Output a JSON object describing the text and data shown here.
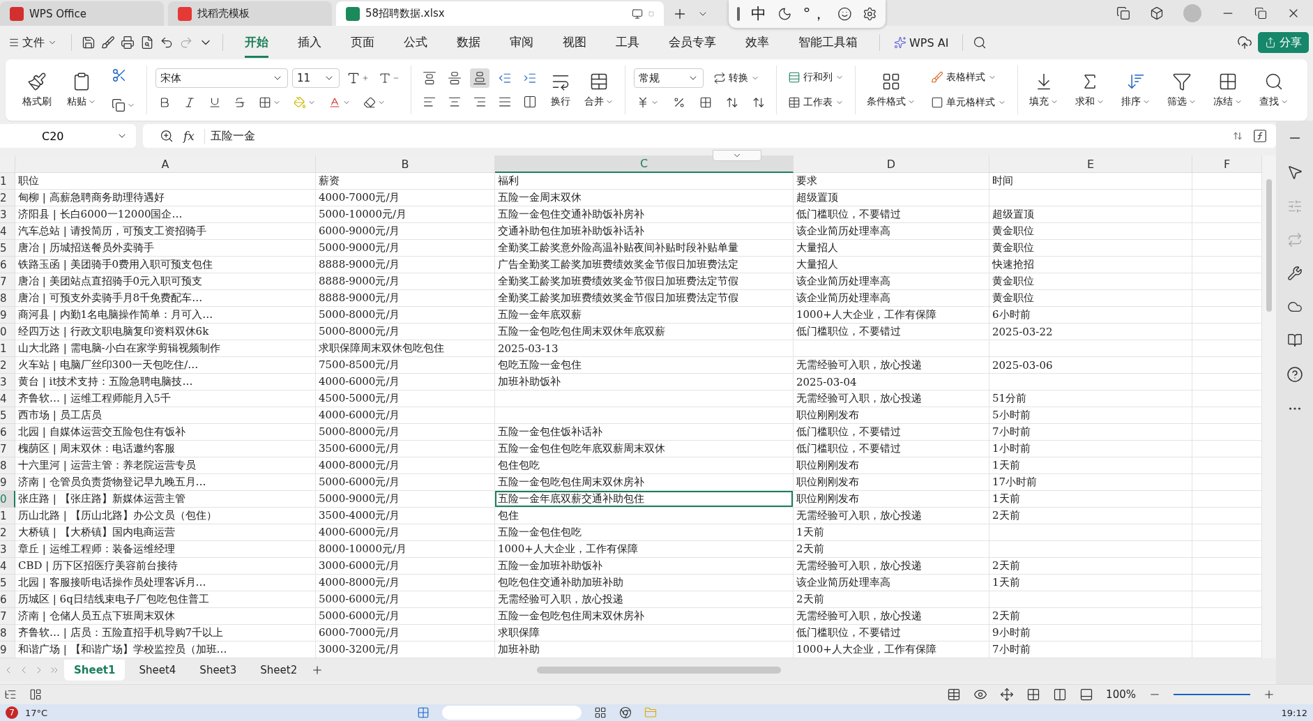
{
  "tabs": [
    {
      "label": "WPS Office",
      "kind": "home",
      "selected": false
    },
    {
      "label": "找稻壳模板",
      "kind": "template",
      "selected": false
    },
    {
      "label": "58招聘数据.xlsx",
      "kind": "sheet",
      "selected": true
    }
  ],
  "ime": {
    "mode": "中",
    "punct": "°，"
  },
  "menu": {
    "file": "文件",
    "tabs": [
      {
        "label": "开始",
        "selected": true
      },
      {
        "label": "插入",
        "selected": false
      },
      {
        "label": "页面",
        "selected": false
      },
      {
        "label": "公式",
        "selected": false
      },
      {
        "label": "数据",
        "selected": false
      },
      {
        "label": "审阅",
        "selected": false
      },
      {
        "label": "视图",
        "selected": false
      },
      {
        "label": "工具",
        "selected": false
      },
      {
        "label": "会员专享",
        "selected": false
      },
      {
        "label": "效率",
        "selected": false
      },
      {
        "label": "智能工具箱",
        "selected": false
      }
    ],
    "ai": "WPS AI",
    "share": "分享"
  },
  "ribbon": {
    "clipboard": [
      {
        "label": "格式刷",
        "kind": "brush"
      },
      {
        "label": "粘贴",
        "kind": "paste"
      }
    ],
    "font": {
      "name": "宋体",
      "size": "11"
    },
    "align_vertical": [
      {
        "kind": "top",
        "selected": false
      },
      {
        "kind": "middle",
        "selected": false
      },
      {
        "kind": "bottom",
        "selected": true
      }
    ],
    "wrap": "换行",
    "merge": "合并",
    "number_format": "常规",
    "convert": "转换",
    "rows_cols": "行和列",
    "worksheet": "工作表",
    "cond_format": "条件格式",
    "table_style": "表格样式",
    "cell_style": "单元格样式",
    "tools": [
      {
        "label": "填充",
        "kind": "fill"
      },
      {
        "label": "求和",
        "kind": "sum"
      },
      {
        "label": "排序",
        "kind": "sort"
      },
      {
        "label": "筛选",
        "kind": "filter"
      },
      {
        "label": "冻结",
        "kind": "freeze"
      },
      {
        "label": "查找",
        "kind": "find"
      }
    ]
  },
  "name_box": "C20",
  "fx": "fx",
  "formula": "五险一金",
  "columns": [
    {
      "label": "A",
      "selected": false
    },
    {
      "label": "B",
      "selected": false
    },
    {
      "label": "C",
      "selected": true
    },
    {
      "label": "D",
      "selected": false
    },
    {
      "label": "E",
      "selected": false
    },
    {
      "label": "F",
      "selected": false
    }
  ],
  "rows": [
    {
      "num": "1",
      "selected": false,
      "cells": [
        "职位",
        "薪资",
        "福利",
        "要求",
        "时间"
      ]
    },
    {
      "num": "2",
      "selected": false,
      "cells": [
        "甸柳 | 高薪急聘商务助理待遇好",
        "4000-7000元/月",
        "五险一金周末双休",
        "超级置顶",
        null
      ]
    },
    {
      "num": "3",
      "selected": false,
      "cells": [
        "济阳县 | 长白6000一12000国企…",
        "5000-10000元/月",
        "五险一金包住交通补助饭补房补",
        "低门槛职位，不要错过",
        "超级置顶"
      ]
    },
    {
      "num": "4",
      "selected": false,
      "cells": [
        "汽车总站 | 请投简历，可预支工资招骑手",
        "6000-9000元/月",
        "交通补助包住加班补助饭补话补",
        "该企业简历处理率高",
        "黄金职位"
      ]
    },
    {
      "num": "5",
      "selected": false,
      "cells": [
        "唐冶 | 历城招送餐员外卖骑手",
        "5000-9000元/月",
        "全勤奖工龄奖意外险高温补贴夜间补贴时段补贴单量",
        "大量招人",
        "黄金职位"
      ]
    },
    {
      "num": "6",
      "selected": false,
      "cells": [
        "铁路玉函 | 美团骑手0费用入职可预支包住",
        "8888-9000元/月",
        "广告全勤奖工龄奖加班费绩效奖金节假日加班费法定",
        "大量招人",
        "快速抢招"
      ]
    },
    {
      "num": "7",
      "selected": false,
      "cells": [
        "唐冶 | 美团站点直招骑手0元入职可预支",
        "8888-9000元/月",
        "全勤奖工龄奖加班费绩效奖金节假日加班费法定节假",
        "该企业简历处理率高",
        "黄金职位"
      ]
    },
    {
      "num": "8",
      "selected": false,
      "cells": [
        "唐冶 | 可预支外卖骑手月8千免费配车…",
        "8888-9000元/月",
        "全勤奖工龄奖加班费绩效奖金节假日加班费法定节假",
        "该企业简历处理率高",
        "黄金职位"
      ]
    },
    {
      "num": "9",
      "selected": false,
      "cells": [
        "商河县 | 内勤1名电脑操作简单：月可入…",
        "5000-8000元/月",
        "五险一金年底双薪",
        "1000+人大企业，工作有保障",
        "6小时前"
      ]
    },
    {
      "num": "0",
      "selected": false,
      "cells": [
        "经四万达 | 行政文职电脑复印资料双休6k",
        "5000-8000元/月",
        "五险一金包吃包住周末双休年底双薪",
        "低门槛职位，不要错过",
        "2025-03-22"
      ]
    },
    {
      "num": "1",
      "selected": false,
      "cells": [
        "山大北路 | 需电脑-小白在家学剪辑视频制作",
        "求职保障周末双休包吃包住",
        "2025-03-13",
        null,
        null
      ]
    },
    {
      "num": "2",
      "selected": false,
      "cells": [
        "火车站 | 电脑厂丝印300一天包吃住/…",
        "7500-8500元/月",
        "包吃五险一金包住",
        "无需经验可入职，放心投递",
        "2025-03-06"
      ]
    },
    {
      "num": "3",
      "selected": false,
      "cells": [
        "黄台 | it技术支持：五险急聘电脑技…",
        "4000-6000元/月",
        "加班补助饭补",
        "2025-03-04",
        null
      ]
    },
    {
      "num": "4",
      "selected": false,
      "cells": [
        "齐鲁软… | 运维工程师能月入5千",
        "4500-5000元/月",
        null,
        "无需经验可入职，放心投递",
        "51分前"
      ]
    },
    {
      "num": "5",
      "selected": false,
      "cells": [
        "西市场 | 员工店员",
        "4000-6000元/月",
        null,
        "职位刚刚发布",
        "5小时前"
      ]
    },
    {
      "num": "6",
      "selected": false,
      "cells": [
        "北园 | 自媒体运营交五险包住有饭补",
        "5000-8000元/月",
        "五险一金包住饭补话补",
        "低门槛职位，不要错过",
        "7小时前"
      ]
    },
    {
      "num": "7",
      "selected": false,
      "cells": [
        "槐荫区 | 周末双休：电话邀约客服",
        "3500-6000元/月",
        "五险一金包住包吃年底双薪周末双休",
        "低门槛职位，不要错过",
        "1小时前"
      ]
    },
    {
      "num": "8",
      "selected": false,
      "cells": [
        "十六里河 | 运营主管：养老院运营专员",
        "4000-8000元/月",
        "包住包吃",
        "职位刚刚发布",
        "1天前"
      ]
    },
    {
      "num": "9",
      "selected": false,
      "cells": [
        "济南 | 仓管员负责货物登记早九晚五月…",
        "5000-6000元/月",
        "五险一金包吃包住周末双休房补",
        "职位刚刚发布",
        "17小时前"
      ]
    },
    {
      "num": "0",
      "selected": true,
      "cells": [
        "张庄路 | 【张庄路】新媒体运营主管",
        "5000-9000元/月",
        "五险一金年底双薪交通补助包住",
        "职位刚刚发布",
        "1天前"
      ]
    },
    {
      "num": "1",
      "selected": false,
      "cells": [
        "历山北路 | 【历山北路】办公文员（包住）",
        "3500-4000元/月",
        "包住",
        "无需经验可入职，放心投递",
        "2天前"
      ]
    },
    {
      "num": "2",
      "selected": false,
      "cells": [
        "大桥镇 | 【大桥镇】国内电商运营",
        "4000-6000元/月",
        "五险一金包住包吃",
        "1天前",
        null
      ]
    },
    {
      "num": "3",
      "selected": false,
      "cells": [
        "章丘 | 运维工程师：装备运维经理",
        "8000-10000元/月",
        "1000+人大企业，工作有保障",
        "2天前",
        null
      ]
    },
    {
      "num": "4",
      "selected": false,
      "cells": [
        "CBD | 历下区招医疗美容前台接待",
        "3000-6000元/月",
        "五险一金加班补助饭补",
        "无需经验可入职，放心投递",
        "2天前"
      ]
    },
    {
      "num": "5",
      "selected": false,
      "cells": [
        "北园 | 客服接听电话操作员处理客诉月…",
        "4000-8000元/月",
        "包吃包住交通补助加班补助",
        "该企业简历处理率高",
        "1天前"
      ]
    },
    {
      "num": "6",
      "selected": false,
      "cells": [
        "历城区 | 6q日结线束电子厂包吃包住普工",
        "5000-6000元/月",
        "无需经验可入职，放心投递",
        "2天前",
        null
      ]
    },
    {
      "num": "7",
      "selected": false,
      "cells": [
        "济南 | 仓储人员五点下班周末双休",
        "5000-6000元/月",
        "五险一金包吃包住周末双休房补",
        "无需经验可入职，放心投递",
        "2天前"
      ]
    },
    {
      "num": "8",
      "selected": false,
      "cells": [
        "齐鲁软… | 店员：五险直招手机导购7千以上",
        "6000-7000元/月",
        "求职保障",
        "低门槛职位，不要错过",
        "9小时前"
      ]
    },
    {
      "num": "9",
      "selected": false,
      "cells": [
        "和谐广场 | 【和谐广场】学校监控员（加班…",
        "3000-3200元/月",
        "加班补助",
        "1000+人大企业，工作有保障",
        "7小时前"
      ]
    }
  ],
  "sheets": [
    {
      "label": "Sheet1",
      "selected": true
    },
    {
      "label": "Sheet4",
      "selected": false
    },
    {
      "label": "Sheet3",
      "selected": false
    },
    {
      "label": "Sheet2",
      "selected": false
    }
  ],
  "status": {
    "zoom": "100%"
  },
  "taskbar": {
    "badge": "7",
    "weather": "17°C",
    "time": "19:12"
  }
}
